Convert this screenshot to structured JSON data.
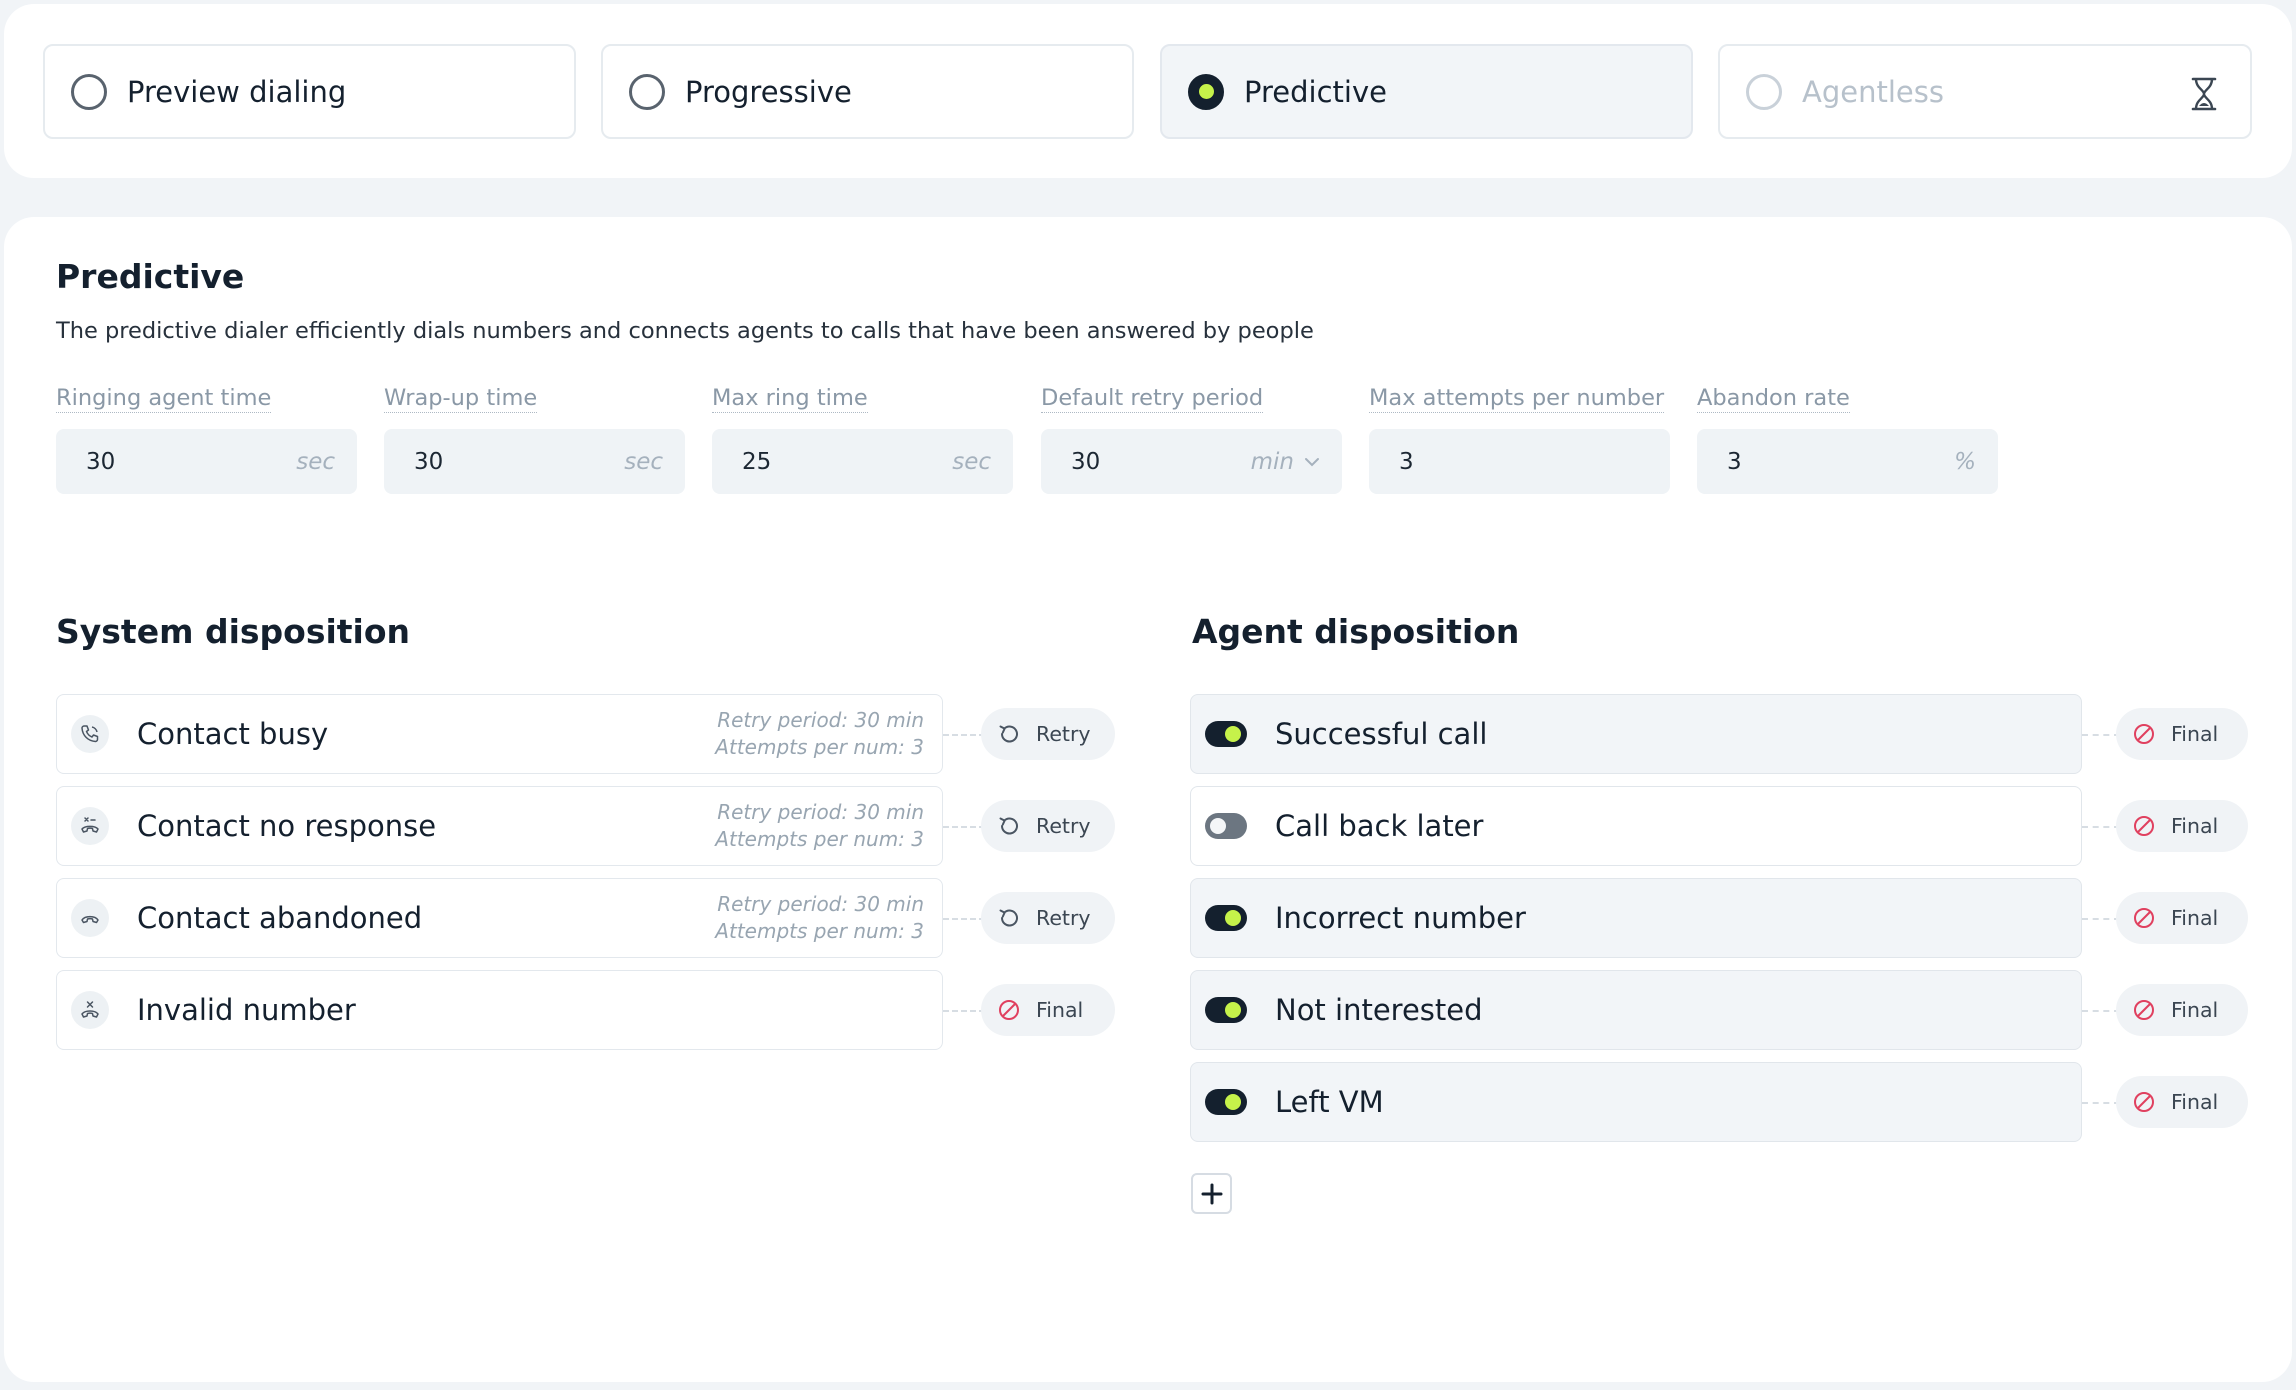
{
  "modes": [
    {
      "label": "Preview dialing",
      "state": "unselected"
    },
    {
      "label": "Progressive",
      "state": "unselected"
    },
    {
      "label": "Predictive",
      "state": "selected"
    },
    {
      "label": "Agentless",
      "state": "disabled",
      "icon": "hourglass-icon"
    }
  ],
  "section": {
    "title": "Predictive",
    "description": "The predictive dialer efficiently dials numbers and connects agents to calls that have been answered by people"
  },
  "fields": {
    "ringing_agent_time": {
      "label": "Ringing agent time",
      "value": "30",
      "unit": "sec"
    },
    "wrap_up_time": {
      "label": "Wrap-up time",
      "value": "30",
      "unit": "sec"
    },
    "max_ring_time": {
      "label": "Max ring time",
      "value": "25",
      "unit": "sec"
    },
    "default_retry_period": {
      "label": "Default retry period",
      "value": "30",
      "unit": "min"
    },
    "max_attempts": {
      "label": "Max attempts per number",
      "value": "3"
    },
    "abandon_rate": {
      "label": "Abandon rate",
      "value": "3",
      "unit": "%"
    }
  },
  "system_disposition": {
    "title": "System disposition",
    "items": [
      {
        "label": "Contact busy",
        "icon": "phone-busy-icon",
        "retry_period": "Retry period: 30 min",
        "attempts": "Attempts per num: 3",
        "action": "Retry"
      },
      {
        "label": "Contact no response",
        "icon": "phone-no-response-icon",
        "retry_period": "Retry period: 30 min",
        "attempts": "Attempts per num: 3",
        "action": "Retry"
      },
      {
        "label": "Contact abandoned",
        "icon": "phone-hangup-icon",
        "retry_period": "Retry period: 30 min",
        "attempts": "Attempts per num: 3",
        "action": "Retry"
      },
      {
        "label": "Invalid number",
        "icon": "phone-invalid-icon",
        "action": "Final"
      }
    ]
  },
  "agent_disposition": {
    "title": "Agent disposition",
    "items": [
      {
        "label": "Successful call",
        "enabled": true,
        "action": "Final"
      },
      {
        "label": "Call back later",
        "enabled": false,
        "action": "Final"
      },
      {
        "label": "Incorrect number",
        "enabled": true,
        "action": "Final"
      },
      {
        "label": "Not interested",
        "enabled": true,
        "action": "Final"
      },
      {
        "label": "Left VM",
        "enabled": true,
        "action": "Final"
      }
    ]
  },
  "colors": {
    "accent": "#c6f24a",
    "dark": "#14202e",
    "final_icon": "#e0405f",
    "muted_label": "#8a98a6"
  }
}
